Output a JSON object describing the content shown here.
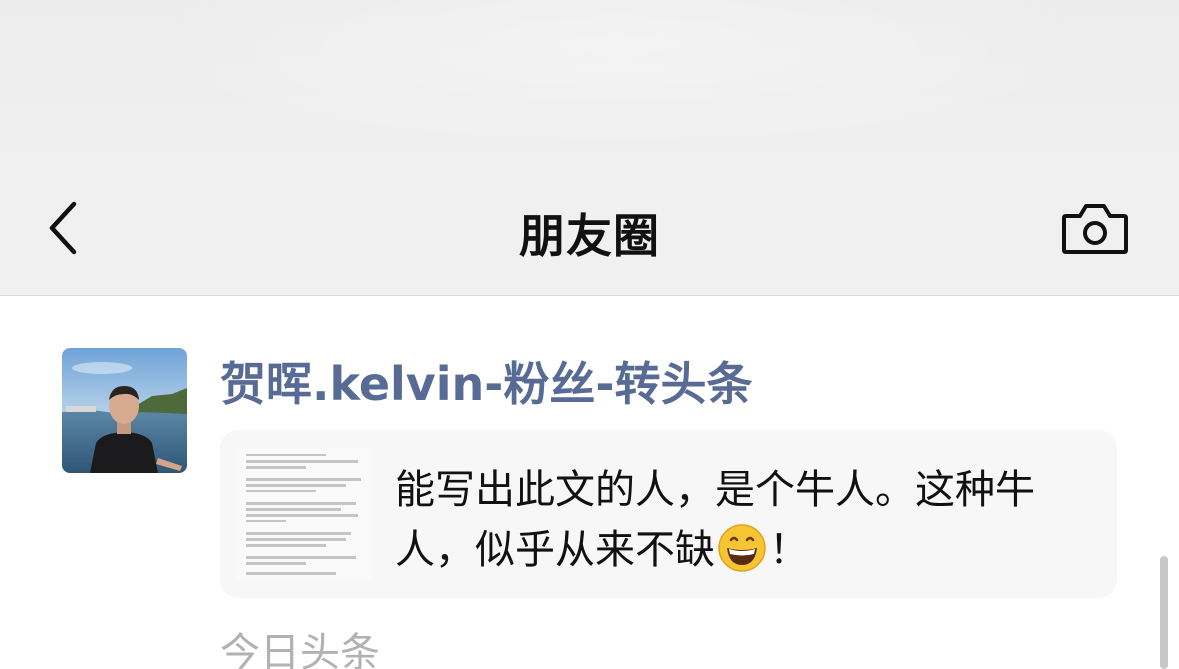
{
  "nav": {
    "title": "朋友圈",
    "back_icon": "chevron-left-icon",
    "camera_icon": "camera-icon"
  },
  "post": {
    "author": "贺晖.kelvin-粉丝-转头条",
    "share_text_part1": "能写出此文的人，是个牛人。这种牛人，似乎从来不缺",
    "share_emoji": "grinning-face-emoji",
    "share_text_part2": "！",
    "source": "今日头条"
  },
  "colors": {
    "author_link": "#576b95",
    "source_gray": "#b2b2b2",
    "card_bg": "#f7f7f7",
    "header_bg": "#efefef"
  }
}
